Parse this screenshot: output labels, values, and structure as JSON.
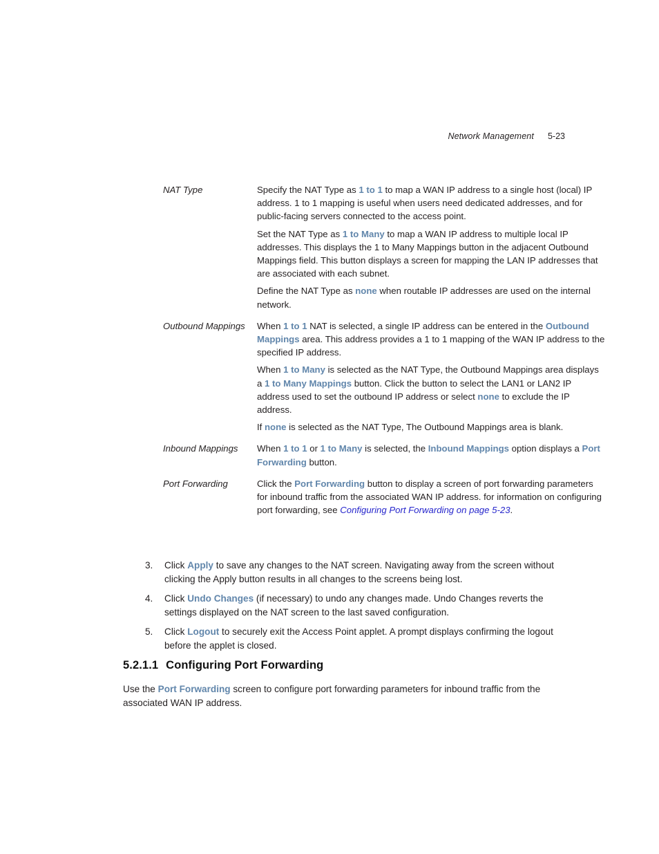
{
  "header": {
    "chapter_title": "Network Management",
    "page_number": "5-23"
  },
  "colors": {
    "ui_term_blue": "#6186ab",
    "crossref_blue": "#2626cc",
    "body_text": "#231f20"
  },
  "definitions": [
    {
      "term": "NAT Type",
      "paragraphs": [
        {
          "parts": [
            {
              "text": "Specify the NAT Type as ",
              "style": "plain"
            },
            {
              "text": "1 to 1",
              "style": "ui"
            },
            {
              "text": " to map a WAN IP address to a single host (local) IP address. 1 to 1 mapping is useful when users need dedicated addresses, and for public-facing servers connected to the access point.",
              "style": "plain"
            }
          ]
        },
        {
          "parts": [
            {
              "text": "Set the NAT Type as ",
              "style": "plain"
            },
            {
              "text": "1 to Many",
              "style": "ui"
            },
            {
              "text": " to map a WAN IP address to multiple local IP addresses. This displays the 1 to Many Mappings button in the adjacent Outbound Mappings field. This button displays a screen for mapping the LAN IP addresses that are associated with each subnet.",
              "style": "plain"
            }
          ]
        },
        {
          "parts": [
            {
              "text": "Define the NAT Type as ",
              "style": "plain"
            },
            {
              "text": "none",
              "style": "ui"
            },
            {
              "text": " when routable IP addresses are used on the internal network.",
              "style": "plain"
            }
          ]
        }
      ]
    },
    {
      "term": "Outbound Mappings",
      "paragraphs": [
        {
          "parts": [
            {
              "text": "When ",
              "style": "plain"
            },
            {
              "text": "1 to 1",
              "style": "ui"
            },
            {
              "text": " NAT is selected, a single IP address can be entered in the ",
              "style": "plain"
            },
            {
              "text": "Outbound Mappings",
              "style": "ui"
            },
            {
              "text": " area. This address provides a 1 to 1 mapping of the WAN IP address to the specified IP address.",
              "style": "plain"
            }
          ]
        },
        {
          "parts": [
            {
              "text": "When ",
              "style": "plain"
            },
            {
              "text": "1 to Many",
              "style": "ui"
            },
            {
              "text": " is selected as the NAT Type, the Outbound Mappings area displays a ",
              "style": "plain"
            },
            {
              "text": "1 to Many Mappings",
              "style": "ui"
            },
            {
              "text": " button. Click the button to select the LAN1 or LAN2 IP address used to set the outbound IP address or select ",
              "style": "plain"
            },
            {
              "text": "none",
              "style": "ui"
            },
            {
              "text": " to exclude the IP address.",
              "style": "plain"
            }
          ]
        },
        {
          "parts": [
            {
              "text": "If ",
              "style": "plain"
            },
            {
              "text": "none",
              "style": "ui"
            },
            {
              "text": " is selected as the NAT Type, The Outbound Mappings area is blank.",
              "style": "plain"
            }
          ]
        }
      ]
    },
    {
      "term": "Inbound Mappings",
      "paragraphs": [
        {
          "parts": [
            {
              "text": "When ",
              "style": "plain"
            },
            {
              "text": "1 to 1",
              "style": "ui"
            },
            {
              "text": " or ",
              "style": "plain"
            },
            {
              "text": "1 to Many",
              "style": "ui"
            },
            {
              "text": " is selected, the ",
              "style": "plain"
            },
            {
              "text": "Inbound Mappings",
              "style": "ui"
            },
            {
              "text": " option displays a ",
              "style": "plain"
            },
            {
              "text": "Port Forwarding",
              "style": "ui"
            },
            {
              "text": " button.",
              "style": "plain"
            }
          ]
        }
      ]
    },
    {
      "term": "Port Forwarding",
      "paragraphs": [
        {
          "parts": [
            {
              "text": "Click the ",
              "style": "plain"
            },
            {
              "text": "Port Forwarding",
              "style": "ui"
            },
            {
              "text": " button to display a screen of port forwarding parameters for inbound traffic from the associated WAN IP address. for information on configuring port forwarding, see ",
              "style": "plain"
            },
            {
              "text": "Configuring Port Forwarding on page 5-23",
              "style": "xref"
            },
            {
              "text": ".",
              "style": "plain"
            }
          ]
        }
      ]
    }
  ],
  "steps": [
    {
      "number": "3.",
      "parts": [
        {
          "text": "Click ",
          "style": "plain"
        },
        {
          "text": "Apply",
          "style": "ui"
        },
        {
          "text": " to save any changes to the NAT screen. Navigating away from the screen without clicking the Apply button results in all changes to the screens being lost.",
          "style": "plain"
        }
      ]
    },
    {
      "number": "4.",
      "parts": [
        {
          "text": "Click ",
          "style": "plain"
        },
        {
          "text": "Undo Changes",
          "style": "ui"
        },
        {
          "text": " (if necessary) to undo any changes made. Undo Changes reverts the settings displayed on the NAT screen to the last saved configuration.",
          "style": "plain"
        }
      ]
    },
    {
      "number": "5.",
      "parts": [
        {
          "text": "Click ",
          "style": "plain"
        },
        {
          "text": "Logout",
          "style": "ui"
        },
        {
          "text": " to securely exit the Access Point applet. A prompt displays confirming the logout before the applet is closed.",
          "style": "plain"
        }
      ]
    }
  ],
  "section": {
    "number": "5.2.1.1",
    "title": "Configuring Port Forwarding"
  },
  "closing_paragraph": {
    "parts": [
      {
        "text": "Use the ",
        "style": "plain"
      },
      {
        "text": "Port Forwarding",
        "style": "ui"
      },
      {
        "text": " screen to configure port forwarding parameters for inbound traffic from the associated WAN IP address.",
        "style": "plain"
      }
    ]
  }
}
